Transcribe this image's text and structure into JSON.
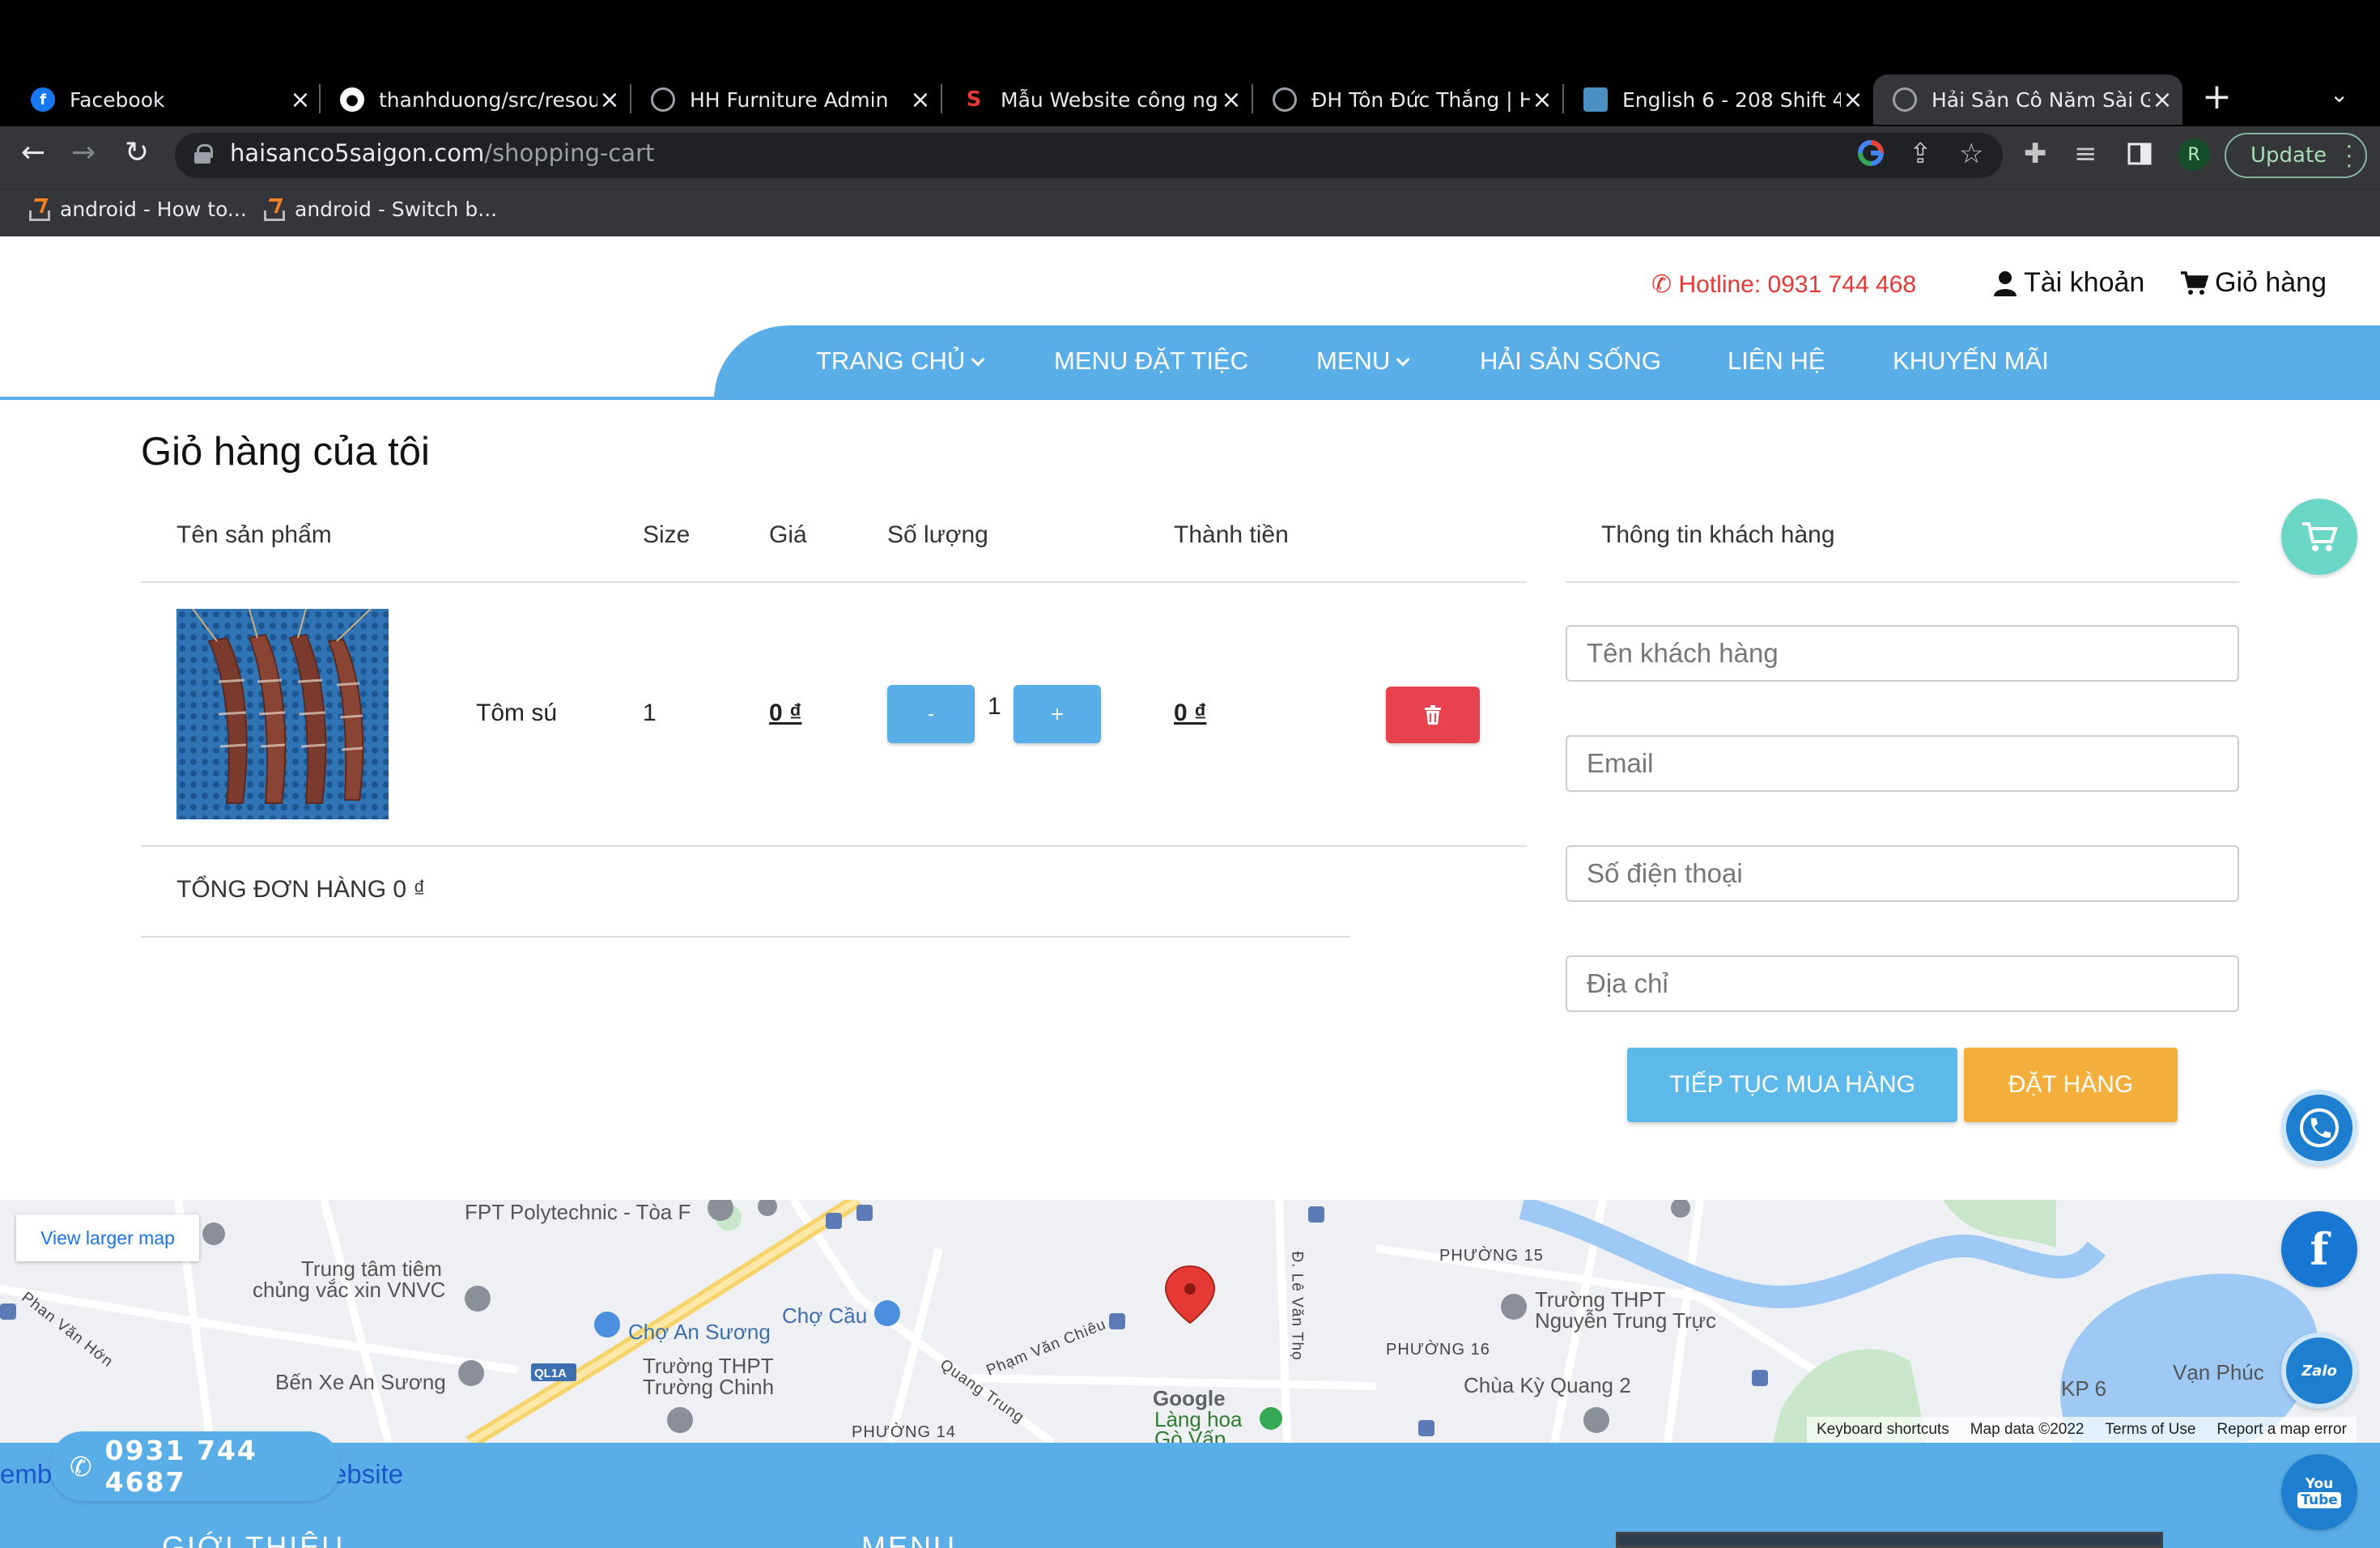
{
  "browser": {
    "tabs": [
      {
        "title": "Facebook",
        "favicon": "facebook-icon",
        "color": "#1877f2"
      },
      {
        "title": "thanhduong/src/resour",
        "favicon": "github-icon",
        "color": "#ffffff"
      },
      {
        "title": "HH Furniture Admin",
        "favicon": "globe-icon",
        "color": "#9aa0a6"
      },
      {
        "title": "Mẫu Website công ngh",
        "favicon": "s-logo-icon",
        "color": "#e53935"
      },
      {
        "title": "ĐH Tôn Đức Thắng | H",
        "favicon": "globe-icon",
        "color": "#9aa0a6"
      },
      {
        "title": "English 6 - 208 Shift 4",
        "favicon": "classroom-icon",
        "color": "#4a90c2"
      },
      {
        "title": "Hải Sản Cô Năm Sài Gò",
        "favicon": "globe-icon",
        "color": "#9aa0a6",
        "active": true
      }
    ],
    "url_host": "haisanco5saigon.com",
    "url_path": "/shopping-cart",
    "profile_initial": "R",
    "update_label": "Update",
    "bookmarks": [
      {
        "title": "android - How to..."
      },
      {
        "title": "android - Switch b..."
      }
    ]
  },
  "header": {
    "hotline": "Hotline: 0931 744 468",
    "account": "Tài khoản",
    "cart": "Giỏ hàng"
  },
  "nav": {
    "items": [
      {
        "label": "TRANG CHỦ",
        "dropdown": true
      },
      {
        "label": "MENU ĐẶT TIỆC",
        "dropdown": false
      },
      {
        "label": "MENU",
        "dropdown": true
      },
      {
        "label": "HẢI SẢN SỐNG",
        "dropdown": false
      },
      {
        "label": "LIÊN HỆ",
        "dropdown": false
      },
      {
        "label": "KHUYẾN MÃI",
        "dropdown": false
      }
    ],
    "color": "#5aaee8"
  },
  "cart": {
    "title": "Giỏ hàng của tôi",
    "columns": {
      "name": "Tên sản phẩm",
      "size": "Size",
      "price": "Giá",
      "qty": "Số lượng",
      "subtotal": "Thành tiền"
    },
    "items": [
      {
        "name": "Tôm sú",
        "size": "1",
        "price": "0 ₫",
        "qty": "1",
        "subtotal": "0 ₫",
        "image": "tiger-prawns-photo"
      }
    ],
    "minus_label": "-",
    "plus_label": "+",
    "total_label": "TỔNG ĐƠN HÀNG 0 ₫"
  },
  "customer": {
    "title": "Thông tin khách hàng",
    "fields": {
      "name": "Tên khách hàng",
      "email": "Email",
      "phone": "Số điện thoại",
      "address": "Địa chỉ"
    },
    "continue_label": "TIẾP TỤC MUA HÀNG",
    "order_label": "ĐẶT HÀNG"
  },
  "map": {
    "view_larger": "View larger map",
    "labels": {
      "fpt": "FPT Polytechnic - Tòa F",
      "vnvc1": "Trung tâm tiêm",
      "vnvc2": "chủng vắc xin VNVC",
      "choanson": "Chợ An Sương",
      "chocau": "Chợ Cầu",
      "benxe": "Bến Xe An Sương",
      "thpt_tc1": "Trường THPT",
      "thpt_tc2": "Trường Chinh",
      "phanvanchieu": "Phạm Văn Chiêu",
      "quangtrung": "Quang Trung",
      "phanvanhon": "Phan Văn Hớn",
      "levantho": "Đ. Lê Văn Thọ",
      "phuong15": "PHƯỜNG 15",
      "phuong16": "PHƯỜNG 16",
      "phuong14": "PHƯỜNG 14",
      "thpt_ntt1": "Trường THPT",
      "thpt_ntt2": "Nguyễn Trung Trực",
      "langhoa1": "Làng hoa",
      "langhoa2": "Gò Vấp",
      "chuaky": "Chùa Kỳ Quang 2",
      "kp6": "KP 6",
      "vanphuc": "Vạn Phúc",
      "ql1a": "QL1A",
      "google": "Google"
    },
    "footer": [
      "Keyboard shortcuts",
      "Map data ©2022",
      "Terms of Use",
      "Report a map error"
    ]
  },
  "footer": {
    "phone": "0931 744 4687",
    "link_left": "emb",
    "link_right": "ebsite",
    "col1": "GIỚI THIỆU",
    "col2": "MENU"
  },
  "floating": {
    "zalo": "Zalo",
    "youtube1": "You",
    "youtube2": "Tube"
  }
}
